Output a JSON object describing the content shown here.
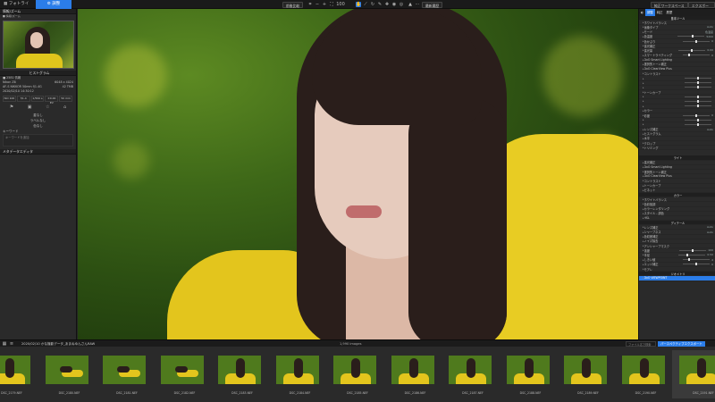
{
  "top": {
    "tabs": [
      {
        "label": "フォトライブラリ"
      },
      {
        "label": "調整"
      }
    ],
    "btn_compare": "前後比較",
    "zoom": "100",
    "btn_recent": "最新履歴",
    "btn_workspace": "純正ワークスペース",
    "btn_export": "エクスポート"
  },
  "left": {
    "section_nav": "情報/ズーム",
    "nav_file_label": "■ 情報/ズーム",
    "section_exif": "ヒストグラム",
    "meta": [
      {
        "k": "■ 2581 情報",
        "v": ""
      },
      {
        "k": "Nikon Z6",
        "v": "6048 x 4024"
      },
      {
        "k": "AF-S NIKKOR 50mm f/1.4G",
        "v": "42 TMB"
      },
      {
        "k": "2020/02/10 14:30:12",
        "v": ""
      }
    ],
    "exif": [
      "ISO 100",
      "f/1.4",
      "1/500 s",
      "±0.00 EV",
      "50 mm"
    ],
    "rating_label": "星なし",
    "label_no_label": "ラベルなし",
    "color_label": "色なし",
    "keywords_title": "キーワード",
    "keywords_placeholder": "キーワードを追加",
    "metadata_footer": "メタデータエディタ"
  },
  "right": {
    "tabs": [
      "調整",
      "純正",
      "履歴"
    ],
    "rows": [
      {
        "label": "基本ツール",
        "type": "hdr"
      },
      {
        "label": "ホワイトバランス",
        "type": "sec"
      },
      {
        "label": "画像タイプ",
        "value": "Auto"
      },
      {
        "label": "モード",
        "value": "色温度"
      },
      {
        "label": "色温度",
        "value": "5200",
        "slider": 0.55
      },
      {
        "label": "色かぶり",
        "value": "0",
        "slider": 0.5
      },
      {
        "label": "露光補正",
        "type": "sec"
      },
      {
        "label": "露光量",
        "value": "0.00",
        "slider": 0.5
      },
      {
        "label": "スマートライティング",
        "value": "0",
        "slider": 0.2
      },
      {
        "label": "DxO Smart Lighting",
        "type": "sub"
      },
      {
        "label": "選択的トーン補正",
        "type": "sub"
      },
      {
        "label": "DxO ClearView Plus",
        "type": "sub"
      },
      {
        "label": "コントラスト",
        "type": "sub"
      },
      {
        "label": "",
        "value": "",
        "slider": 0.5
      },
      {
        "label": "",
        "value": "",
        "slider": 0.5
      },
      {
        "label": "",
        "value": "",
        "slider": 0.5
      },
      {
        "label": "トーンカーブ",
        "type": "sub"
      },
      {
        "label": "",
        "value": "",
        "slider": 0.5
      },
      {
        "label": "",
        "value": "",
        "slider": 0.5
      },
      {
        "label": "",
        "value": "",
        "slider": 0.5
      },
      {
        "label": "カラー",
        "type": "sub"
      },
      {
        "label": "彩度",
        "value": "0",
        "slider": 0.5
      },
      {
        "label": "",
        "value": "",
        "slider": 0.5
      },
      {
        "label": "",
        "value": "",
        "slider": 0.5
      },
      {
        "label": "レンズ補正",
        "value": "Auto"
      },
      {
        "label": "ヒストグラム",
        "value": ""
      },
      {
        "label": "水平",
        "value": ""
      },
      {
        "label": "クロップ",
        "value": ""
      },
      {
        "label": "トリミング",
        "value": ""
      },
      {
        "label": "",
        "type": "gap"
      },
      {
        "label": "ライト",
        "type": "hdr"
      },
      {
        "label": "露光補正",
        "type": "sub"
      },
      {
        "label": "DxO Smart Lighting",
        "type": "sub"
      },
      {
        "label": "選択的トーン補正",
        "type": "sub"
      },
      {
        "label": "DxO ClearView Plus",
        "type": "sub"
      },
      {
        "label": "コントラスト",
        "type": "sub"
      },
      {
        "label": "トーンカーブ",
        "type": "sub"
      },
      {
        "label": "ビネット",
        "type": "sub"
      },
      {
        "label": "カラー",
        "type": "hdr"
      },
      {
        "label": "ホワイトバランス",
        "type": "sub"
      },
      {
        "label": "色彩強調",
        "type": "sub"
      },
      {
        "label": "カラーレンダリング",
        "type": "sub"
      },
      {
        "label": "スタイル - 調色",
        "type": "sub"
      },
      {
        "label": "HSL",
        "type": "sub"
      },
      {
        "label": "ディテール",
        "type": "hdr"
      },
      {
        "label": "レンズ補正",
        "value": "Auto"
      },
      {
        "label": "シャープネス",
        "value": "Auto"
      },
      {
        "label": "色収差補正",
        "value": ""
      },
      {
        "label": "ノイズ除去",
        "value": ""
      },
      {
        "label": "アンシャープマスク",
        "type": "sub"
      },
      {
        "label": "強度",
        "value": "100",
        "slider": 0.5
      },
      {
        "label": "半径",
        "value": "0.50",
        "slider": 0.3
      },
      {
        "label": "しきい値",
        "value": "4",
        "slider": 0.2
      },
      {
        "label": "エッジ補正",
        "value": "0",
        "slider": 0.5
      },
      {
        "label": "モアレ",
        "value": ""
      },
      {
        "label": "ジオメトリ",
        "type": "hdr"
      },
      {
        "label": "DxO VIEWPOINT",
        "type": "sel"
      }
    ]
  },
  "filmstrip": {
    "path": "2020/02/10 かな撮影データ_あまねゆんさんRAW",
    "count": "1,990 images",
    "filter_placeholder": "ファイル名で検索",
    "selected_btn": "パースペクティブエクスポート",
    "items": [
      {
        "name": "DSC_2179.NEF",
        "lie": false
      },
      {
        "name": "DSC_2180.NEF",
        "lie": true
      },
      {
        "name": "DSC_2181.NEF",
        "lie": true
      },
      {
        "name": "DSC_2182.NEF",
        "lie": true
      },
      {
        "name": "DSC_2183.NEF",
        "lie": false
      },
      {
        "name": "DSC_2184.NEF",
        "lie": false
      },
      {
        "name": "DSC_2185.NEF",
        "lie": false
      },
      {
        "name": "DSC_2186.NEF",
        "lie": false
      },
      {
        "name": "DSC_2187.NEF",
        "lie": false
      },
      {
        "name": "DSC_2188.NEF",
        "lie": false
      },
      {
        "name": "DSC_2189.NEF",
        "lie": false
      },
      {
        "name": "DSC_2190.NEF",
        "lie": false
      },
      {
        "name": "DSC_2191.NEF",
        "lie": false
      }
    ]
  }
}
